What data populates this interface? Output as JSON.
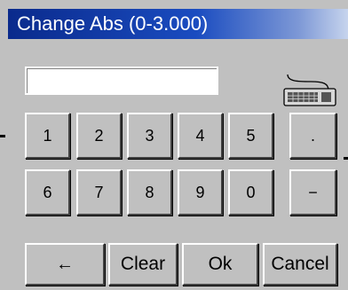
{
  "dialog": {
    "title": "Change Abs (0-3.000)",
    "input_value": ""
  },
  "keypad": {
    "row1": [
      "1",
      "2",
      "3",
      "4",
      "5",
      "."
    ],
    "row2": [
      "6",
      "7",
      "8",
      "9",
      "0",
      "−"
    ]
  },
  "actions": {
    "backspace": "←",
    "clear": "Clear",
    "ok": "Ok",
    "cancel": "Cancel"
  },
  "icons": {
    "keyboard": "keyboard-icon"
  }
}
